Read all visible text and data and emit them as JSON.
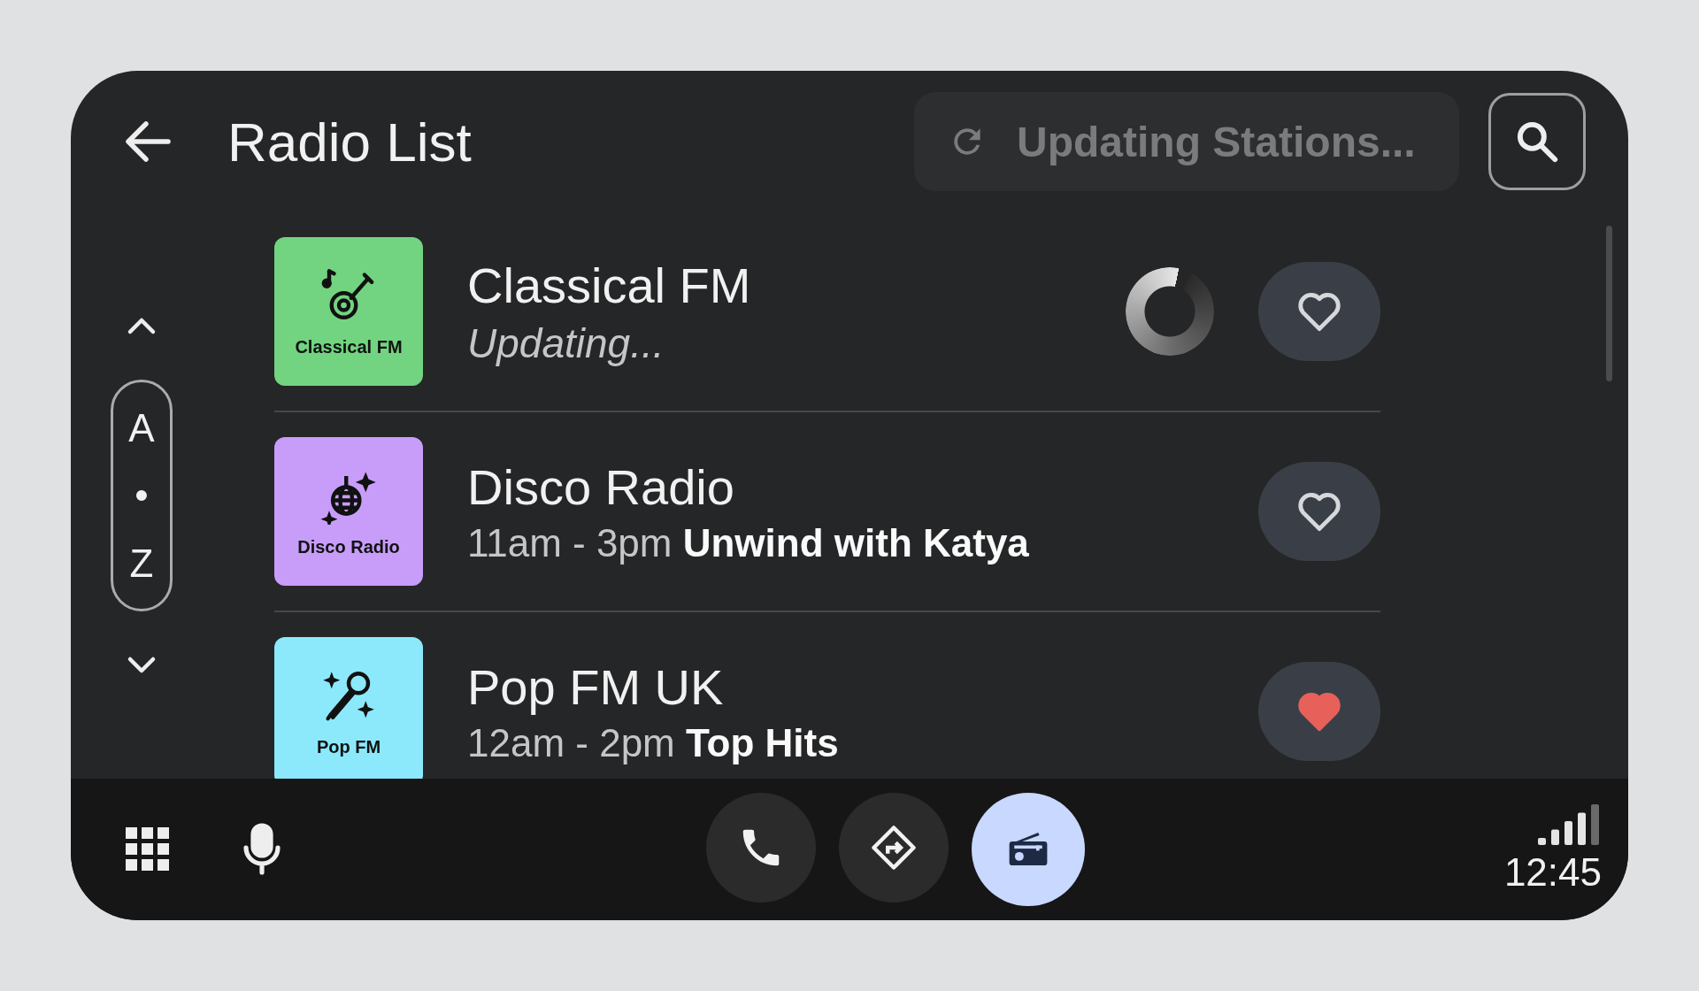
{
  "header": {
    "title": "Radio List",
    "status": "Updating Stations..."
  },
  "index": {
    "labels": [
      "A",
      "•",
      "Z"
    ]
  },
  "stations": [
    {
      "tile_label": "Classical FM",
      "color": "#72d481",
      "name": "Classical FM",
      "subtitle": "Updating...",
      "kind": "status",
      "loading": true,
      "favorite": false
    },
    {
      "tile_label": "Disco Radio",
      "color": "#c89dfa",
      "name": "Disco Radio",
      "subtitle": "11am - 3pm **Unwind with Katya**",
      "kind": "schedule",
      "loading": false,
      "favorite": false
    },
    {
      "tile_label": "Pop FM",
      "color": "#8be9fb",
      "name": "Pop FM UK",
      "subtitle": "12am - 2pm **Top Hits**",
      "kind": "schedule",
      "loading": false,
      "favorite": true
    }
  ],
  "nav": [
    {
      "kind": "phone",
      "selected": false
    },
    {
      "kind": "navigation",
      "selected": false
    },
    {
      "kind": "radio",
      "selected": true
    }
  ],
  "status_bar": {
    "time": "12:45"
  }
}
